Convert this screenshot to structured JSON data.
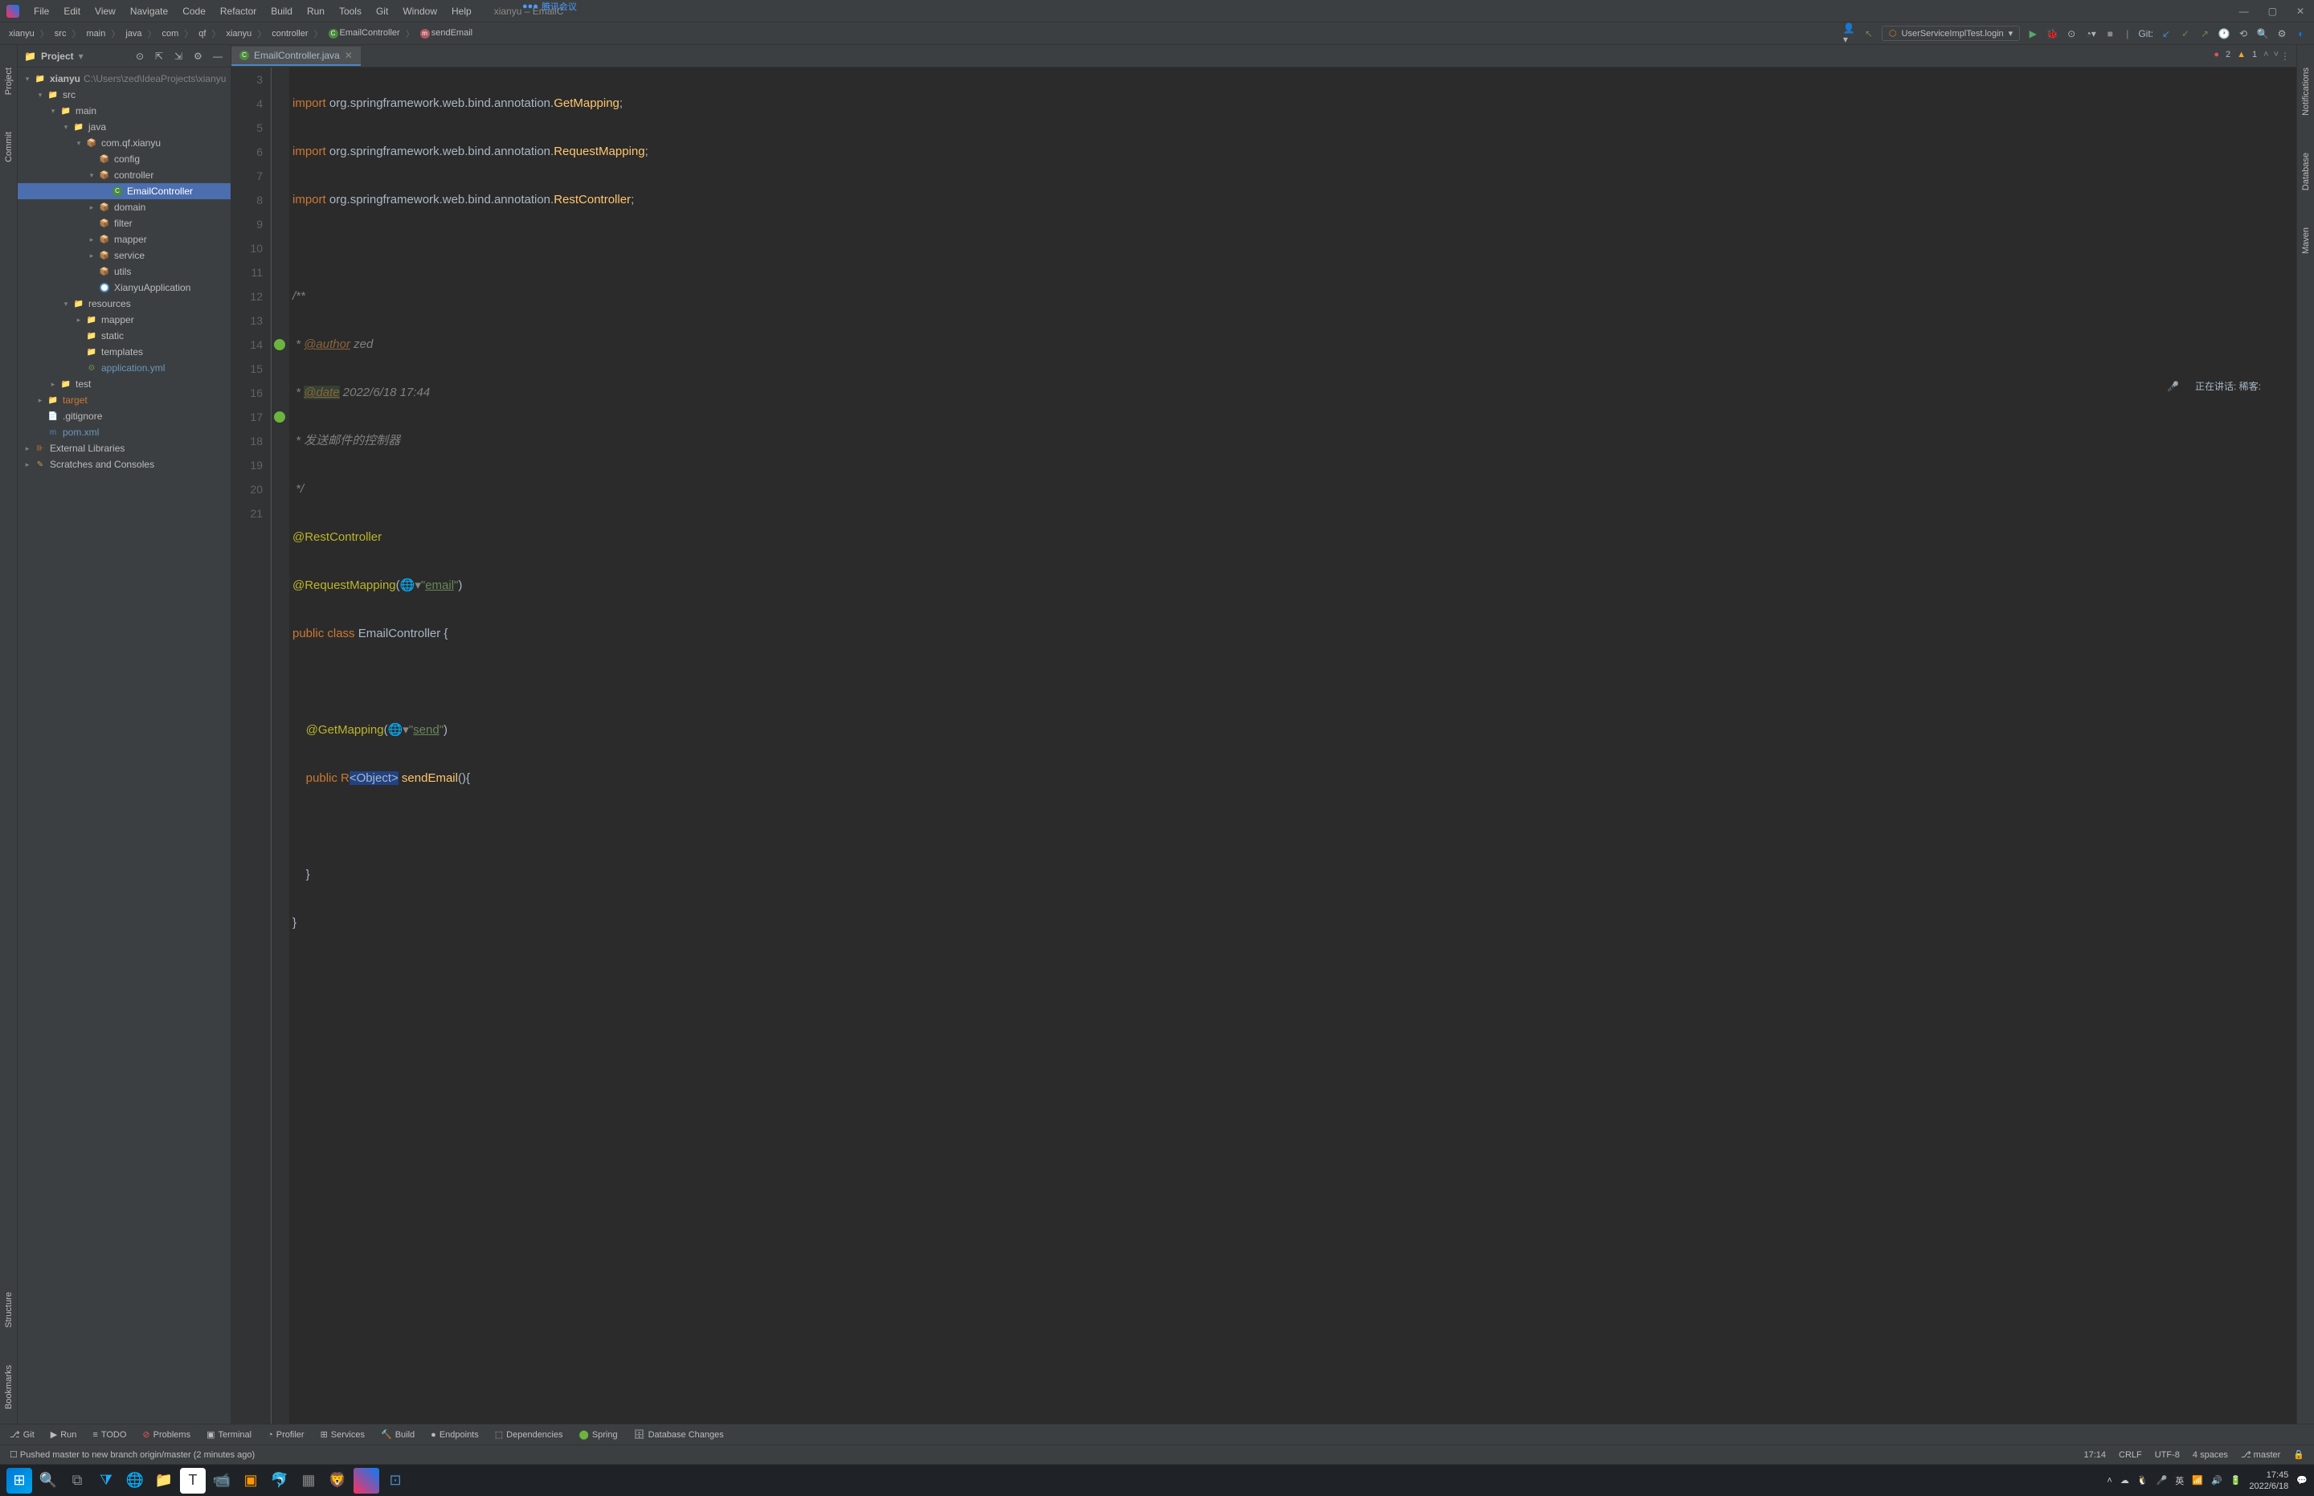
{
  "titlebar": {
    "menus": [
      "File",
      "Edit",
      "View",
      "Navigate",
      "Code",
      "Refactor",
      "Build",
      "Run",
      "Tools",
      "Git",
      "Window",
      "Help"
    ],
    "title": "xianyu – EmailC",
    "overlay_app": "腾讯会议"
  },
  "breadcrumb": {
    "items": [
      "xianyu",
      "src",
      "main",
      "java",
      "com",
      "qf",
      "xianyu",
      "controller"
    ],
    "class": "EmailController",
    "method": "sendEmail"
  },
  "run_config": "UserServiceImplTest.login",
  "sidebar_left": {
    "project": "Project",
    "commit": "Commit",
    "structure": "Structure",
    "bookmarks": "Bookmarks"
  },
  "sidebar_right": {
    "notifications": "Notifications",
    "database": "Database",
    "maven": "Maven"
  },
  "project_panel": {
    "title": "Project",
    "root": "xianyu",
    "root_path": "C:\\Users\\zed\\IdeaProjects\\xianyu",
    "src": "src",
    "main": "main",
    "java": "java",
    "pkg": "com.qf.xianyu",
    "config": "config",
    "controller": "controller",
    "email_controller": "EmailController",
    "domain": "domain",
    "filter": "filter",
    "mapper": "mapper",
    "service": "service",
    "utils": "utils",
    "app": "XianyuApplication",
    "resources": "resources",
    "res_mapper": "mapper",
    "static": "static",
    "templates": "templates",
    "app_yml": "application.yml",
    "test": "test",
    "target": "target",
    "gitignore": ".gitignore",
    "pom": "pom.xml",
    "ext_libs": "External Libraries",
    "scratches": "Scratches and Consoles"
  },
  "tab": {
    "file": "EmailController.java"
  },
  "inspection": {
    "errors": "2",
    "warnings": "1"
  },
  "code": {
    "l3": {
      "kw": "import",
      "pkg": " org.springframework.web.bind.annotation.",
      "cls": "GetMapping",
      "end": ";"
    },
    "l4": {
      "kw": "import",
      "pkg": " org.springframework.web.bind.annotation.",
      "cls": "RequestMapping",
      "end": ";"
    },
    "l5": {
      "kw": "import",
      "pkg": " org.springframework.web.bind.annotation.",
      "cls": "RestController",
      "end": ";"
    },
    "l7": "/**",
    "l8_pre": " * ",
    "l8_tag": "@author",
    "l8_val": " zed",
    "l9_pre": " * ",
    "l9_tag": "@date",
    "l9_val": " 2022/6/18 17:44",
    "l10": " * 发送邮件的控制器",
    "l11": " */",
    "l12": "@RestController",
    "l13_ann": "@RequestMapping",
    "l13_open": "(",
    "l13_str_q1": "\"",
    "l13_str": "email",
    "l13_str_q2": "\"",
    "l13_close": ")",
    "l14_pub": "public ",
    "l14_cls": "class ",
    "l14_name": "EmailController ",
    "l14_brace": "{",
    "l16_ann": "    @GetMapping",
    "l16_open": "(",
    "l16_str_q1": "\"",
    "l16_str": "send",
    "l16_str_q2": "\"",
    "l16_close": ")",
    "l17_pub": "    public ",
    "l17_r": "R",
    "l17_gen": "<Object>",
    "l17_sp": " ",
    "l17_method": "sendEmail",
    "l17_parens": "(){",
    "l19": "    }",
    "l20": "}"
  },
  "line_numbers": [
    "3",
    "4",
    "5",
    "6",
    "7",
    "8",
    "9",
    "10",
    "11",
    "12",
    "13",
    "14",
    "15",
    "16",
    "17",
    "18",
    "19",
    "20",
    "21"
  ],
  "overlay_meet": "正在讲话: 稀客:",
  "bottom_tools": {
    "git": "Git",
    "run": "Run",
    "todo": "TODO",
    "problems": "Problems",
    "terminal": "Terminal",
    "profiler": "Profiler",
    "services": "Services",
    "build": "Build",
    "endpoints": "Endpoints",
    "dependencies": "Dependencies",
    "spring": "Spring",
    "db_changes": "Database Changes"
  },
  "status": {
    "message": "Pushed master to new branch origin/master (2 minutes ago)",
    "pos": "17:14",
    "eol": "CRLF",
    "encoding": "UTF-8",
    "indent": "4 spaces",
    "branch": "master"
  },
  "vcs_label": "Git:",
  "taskbar": {
    "ime": "英",
    "time": "17:45",
    "date": "2022/6/18"
  }
}
